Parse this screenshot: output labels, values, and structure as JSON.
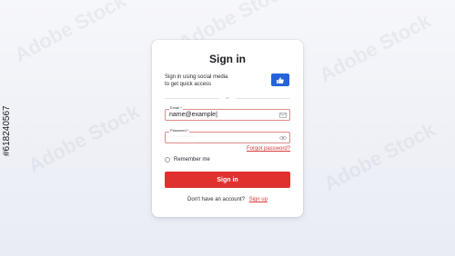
{
  "title": "Sign in",
  "social": {
    "text_line1": "Sign in using social media",
    "text_line2": "to get quick access"
  },
  "divider_text": "or",
  "email": {
    "label": "Email *",
    "value": "name@example|"
  },
  "password": {
    "label": "Password *",
    "value": "·········"
  },
  "forgot_password": "Forgot password?",
  "remember_me": "Remember me",
  "signin_button": "Sign in",
  "footer": {
    "text": "Don't have an account?",
    "signup": "Sign up"
  },
  "watermark": {
    "brand": "Adobe Stock",
    "id": "#618240567"
  },
  "colors": {
    "accent_blue": "#2563d9",
    "primary_red": "#e0312f",
    "error_border": "#e08a8a"
  }
}
